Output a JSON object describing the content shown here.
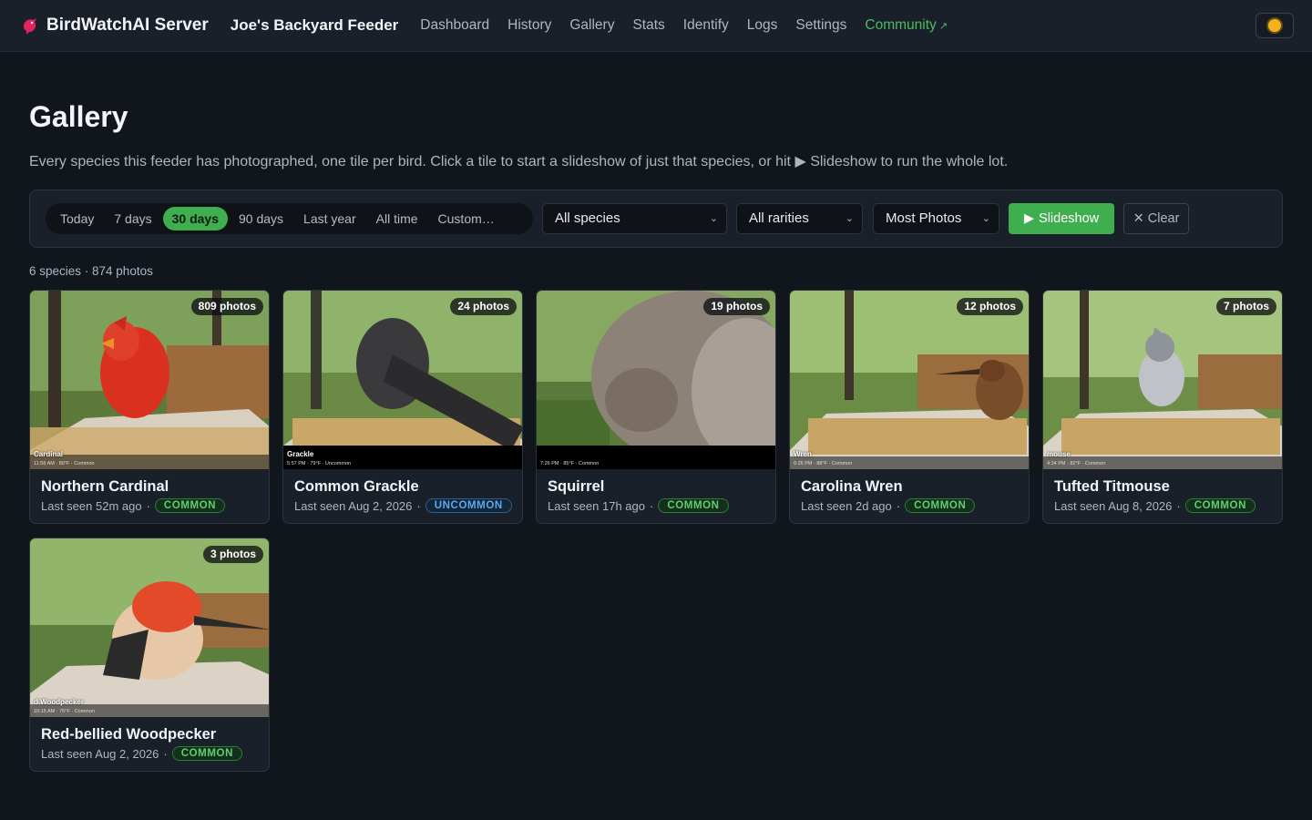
{
  "nav": {
    "brand": "BirdWatchAI Server",
    "feeder": "Joe's Backyard Feeder",
    "links": [
      "Dashboard",
      "History",
      "Gallery",
      "Stats",
      "Identify",
      "Logs",
      "Settings"
    ],
    "community": "Community",
    "community_icon": "external-link-icon"
  },
  "header": {
    "title": "Gallery",
    "description": "Every species this feeder has photographed, one tile per bird. Click a tile to start a slideshow of just that species, or hit ▶ Slideshow to run the whole lot."
  },
  "filters": {
    "ranges": [
      "Today",
      "7 days",
      "30 days",
      "90 days",
      "Last year",
      "All time",
      "Custom…"
    ],
    "active_range": "30 days",
    "species": "All species",
    "rarity": "All rarities",
    "sort": "Most Photos",
    "slideshow": "Slideshow",
    "clear": "Clear"
  },
  "summary": "6 species · 874 photos",
  "cards": [
    {
      "name": "Northern Cardinal",
      "photos": "809 photos",
      "last_seen": "Last seen 52m ago",
      "rarity": "COMMON",
      "cam_label": "Cardinal",
      "cam_sub": "11:58 AM · 89°F · Common"
    },
    {
      "name": "Common Grackle",
      "photos": "24 photos",
      "last_seen": "Last seen Aug 2, 2026",
      "rarity": "UNCOMMON",
      "cam_label": "Grackle",
      "cam_sub": "5:57 PM · 79°F · Uncommon"
    },
    {
      "name": "Squirrel",
      "photos": "19 photos",
      "last_seen": "Last seen 17h ago",
      "rarity": "COMMON",
      "cam_label": "",
      "cam_sub": "7:26 PM · 85°F · Common"
    },
    {
      "name": "Carolina Wren",
      "photos": "12 photos",
      "last_seen": "Last seen 2d ago",
      "rarity": "COMMON",
      "cam_label": "Wren",
      "cam_sub": "6:26 PM · 88°F · Common"
    },
    {
      "name": "Tufted Titmouse",
      "photos": "7 photos",
      "last_seen": "Last seen Aug 8, 2026",
      "rarity": "COMMON",
      "cam_label": "mouse",
      "cam_sub": "4:34 PM · 82°F · Common"
    },
    {
      "name": "Red-bellied Woodpecker",
      "photos": "3 photos",
      "last_seen": "Last seen Aug 2, 2026",
      "rarity": "COMMON",
      "cam_label": "d Woodpecker",
      "cam_sub": "10:15 AM · 76°F · Common"
    }
  ],
  "colors": {
    "accent": "#3fae4f",
    "background": "#11151c",
    "panel": "#1a2029"
  }
}
